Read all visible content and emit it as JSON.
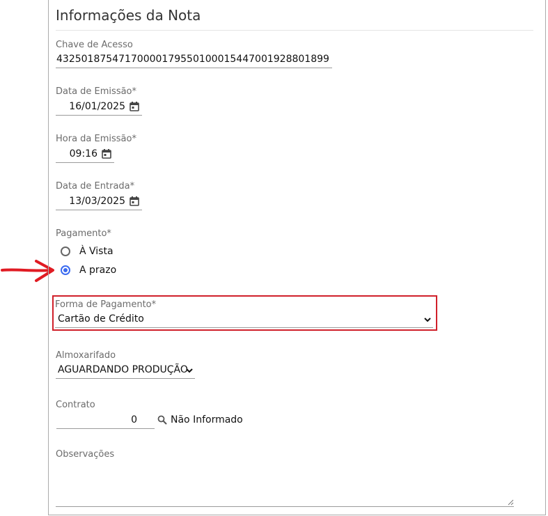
{
  "section": {
    "title": "Informações da Nota"
  },
  "chave": {
    "label": "Chave de Acesso",
    "value": "43250187547170000179550100015447001928801899"
  },
  "data_emissao": {
    "label": "Data de Emissão*",
    "value": "16/01/2025"
  },
  "hora_emissao": {
    "label": "Hora da Emissão*",
    "value": "09:16"
  },
  "data_entrada": {
    "label": "Data de Entrada*",
    "value": "13/03/2025"
  },
  "pagamento": {
    "label": "Pagamento*",
    "options": [
      "À Vista",
      "A prazo"
    ],
    "selected": "A prazo"
  },
  "forma_pagamento": {
    "label": "Forma de Pagamento*",
    "value": "Cartão de Crédito"
  },
  "almoxarifado": {
    "label": "Almoxarifado",
    "value": "AGUARDANDO PRODUÇÃO"
  },
  "contrato": {
    "label": "Contrato",
    "value": "0",
    "status": "Não Informado"
  },
  "observacoes": {
    "label": "Observações"
  },
  "colors": {
    "accent": "#3b6bf0",
    "highlight": "#d0202a",
    "arrow": "#e01b23"
  },
  "icons": {
    "calendar": "calendar-icon",
    "chevron": "chevron-down-icon",
    "search": "search-icon",
    "arrow": "arrow-right-icon"
  }
}
